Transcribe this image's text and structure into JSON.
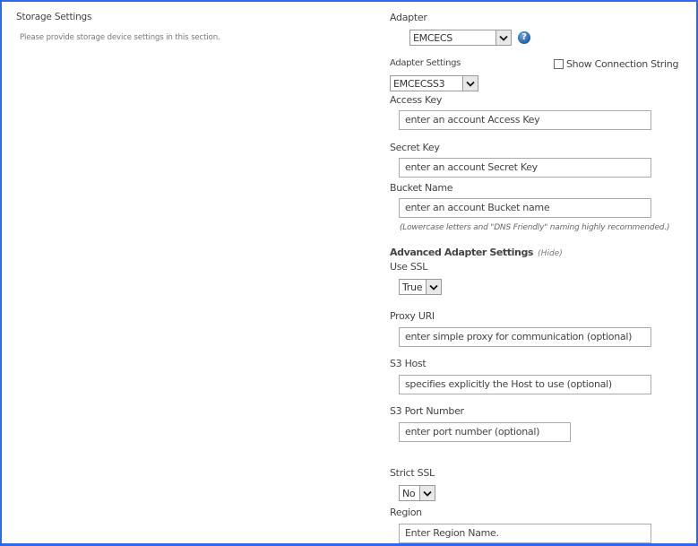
{
  "section": {
    "title": "Storage Settings",
    "description": "Please provide storage device settings in this section."
  },
  "adapter": {
    "label": "Adapter",
    "selected": "EMCECS",
    "help_icon": "help-icon"
  },
  "adapter_settings": {
    "label": "Adapter Settings",
    "selected": "EMCECSS3",
    "show_connection_string": {
      "label": "Show Connection String",
      "checked": false
    }
  },
  "access_key": {
    "label": "Access Key",
    "placeholder": "enter an account Access Key"
  },
  "secret_key": {
    "label": "Secret Key",
    "placeholder": "enter an account Secret Key"
  },
  "bucket_name": {
    "label": "Bucket Name",
    "placeholder": "enter an account Bucket name",
    "hint": "(Lowercase letters and \"DNS Friendly\" naming highly recommended.)"
  },
  "advanced": {
    "title": "Advanced Adapter Settings",
    "toggle_label": "(Hide)"
  },
  "use_ssl": {
    "label": "Use SSL",
    "selected": "True"
  },
  "proxy_uri": {
    "label": "Proxy URI",
    "placeholder": "enter simple proxy for communication (optional)"
  },
  "s3_host": {
    "label": "S3 Host",
    "placeholder": "specifies explicitly the Host to use (optional)"
  },
  "s3_port": {
    "label": "S3 Port Number",
    "placeholder": "enter port number (optional)"
  },
  "strict_ssl": {
    "label": "Strict SSL",
    "selected": "No"
  },
  "region": {
    "label": "Region",
    "placeholder": "Enter Region Name."
  },
  "colors": {
    "frame_border": "#3366ee",
    "help_icon": "#1f5fa8"
  }
}
